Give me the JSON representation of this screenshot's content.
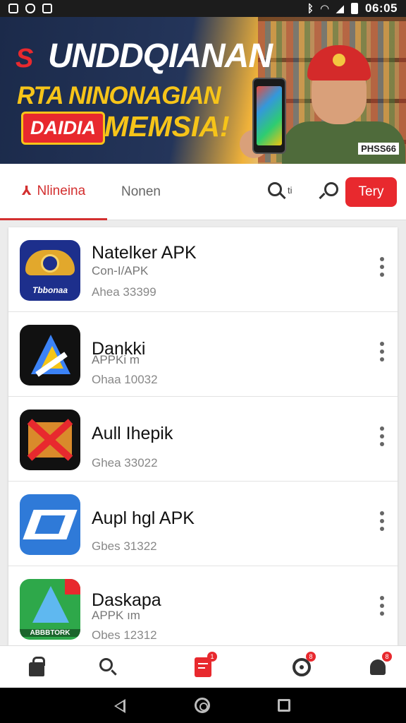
{
  "status_bar": {
    "time": "06:05",
    "icons": [
      "notification-icon",
      "shield-icon",
      "photo-icon",
      "bluetooth-icon",
      "wifi-icon",
      "signal-icon",
      "battery-icon"
    ]
  },
  "banner": {
    "logo_mark": "S",
    "brand": "UNDDQIANAN",
    "line2": "RTA NINONAGIAN",
    "badge": "DAIDIA",
    "line3": "MEMSIA!",
    "tag": "PHSS66"
  },
  "tabs": {
    "active_label": "Nlineina",
    "second_label": "Nonen",
    "search_small_label": "ti",
    "action_button": "Tery"
  },
  "apps": [
    {
      "name": "Natelker APK",
      "sub": "Con-I/APK",
      "count": "Ahea 33399"
    },
    {
      "name": "Dankki",
      "sub": "APPKi m",
      "count": "Ohaa 10032"
    },
    {
      "name": "Aull Ihepik",
      "sub": "",
      "count": "Ghea 33022"
    },
    {
      "name": "Aupl hgl APK",
      "sub": "",
      "count": "Gbes 31322"
    },
    {
      "name": "Daskapa",
      "sub": "APPK ım",
      "count": "Obes 12312"
    }
  ],
  "app_icon_labels": [
    "Tbbonaa",
    "ABBBTORK"
  ],
  "bottom_nav": {
    "badges": [
      "1",
      "8",
      "8"
    ]
  },
  "colors": {
    "accent": "#e8292e",
    "status_bar": "#1c1c1c"
  }
}
